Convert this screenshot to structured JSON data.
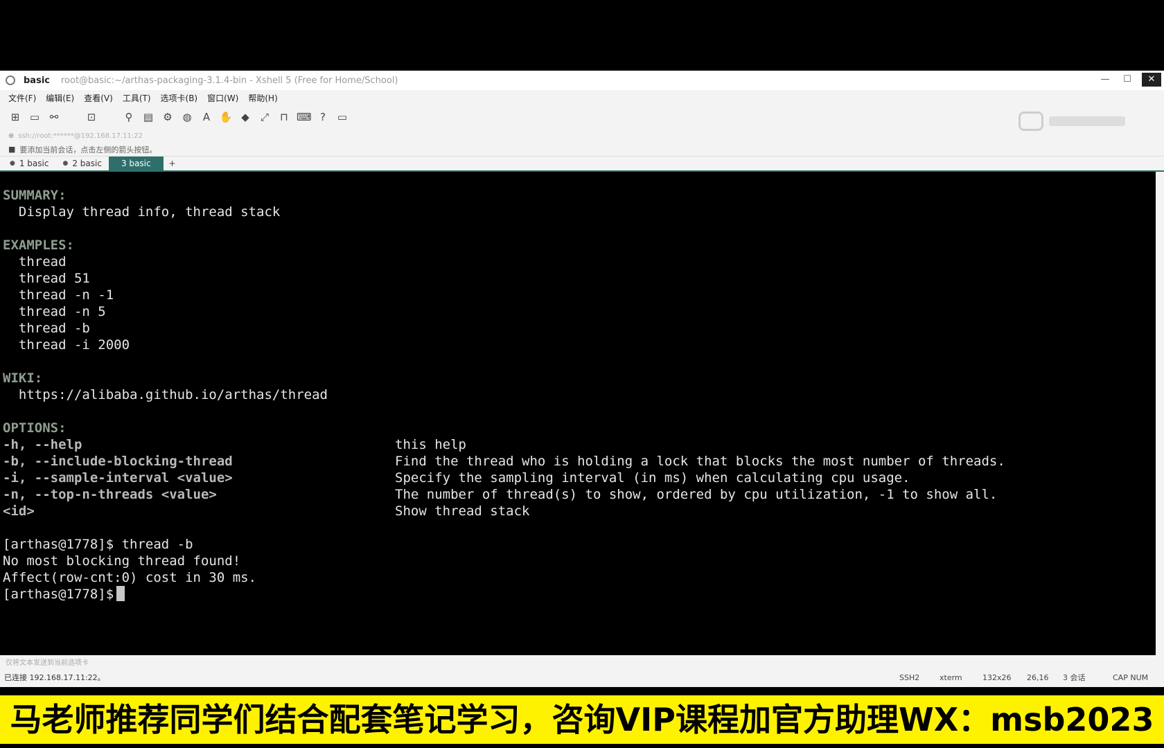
{
  "titlebar": {
    "session_name": "basic",
    "title": "root@basic:~/arthas-packaging-3.1.4-bin - Xshell 5 (Free for Home/School)",
    "min_glyph": "—",
    "max_glyph": "☐",
    "close_glyph": "✕"
  },
  "menu": [
    "文件(F)",
    "编辑(E)",
    "查看(V)",
    "工具(T)",
    "选项卡(B)",
    "窗口(W)",
    "帮助(H)"
  ],
  "addressbar": {
    "icon": "⊕",
    "text": "ssh://root:******@192.168.17.11:22"
  },
  "hintbar": {
    "icon": "■",
    "text": "要添加当前会话，点击左侧的箭头按钮。"
  },
  "tabs": [
    {
      "label": "1 basic",
      "dot": "●"
    },
    {
      "label": "2 basic",
      "dot": "●"
    },
    {
      "label": "3 basic",
      "active": true
    }
  ],
  "tab_add": "+",
  "terminal": {
    "summary_header": "SUMMARY:",
    "summary_text": "  Display thread info, thread stack",
    "examples_header": "EXAMPLES:",
    "examples": [
      "  thread",
      "  thread 51",
      "  thread -n -1",
      "  thread -n 5",
      "  thread -b",
      "  thread -i 2000"
    ],
    "wiki_header": "WIKI:",
    "wiki_url": "  https://alibaba.github.io/arthas/thread",
    "options_header": "OPTIONS:",
    "options": [
      {
        "flag": "-h, --help",
        "desc": "this help"
      },
      {
        "flag": "-b, --include-blocking-thread",
        "desc": "Find the thread who is holding a lock that blocks the most number of threads."
      },
      {
        "flag": "-i, --sample-interval <value>",
        "desc": "Specify the sampling interval (in ms) when calculating cpu usage."
      },
      {
        "flag": "-n, --top-n-threads <value>",
        "desc": "The number of thread(s) to show, ordered by cpu utilization, -1 to show all."
      },
      {
        "flag": "<id>",
        "desc": "Show thread stack"
      }
    ],
    "cmd_line": "[arthas@1778]$ thread -b",
    "result_line": "No most blocking thread found!",
    "affect_line": "Affect(row-cnt:0) cost in 30 ms.",
    "prompt": "[arthas@1778]$"
  },
  "statusbar1": {
    "text": "仅将文本发送到当前选项卡"
  },
  "statusbar2": {
    "connection": "已连接 192.168.17.11:22。",
    "protocol": "SSH2",
    "term_type": "xterm",
    "size": "132x26",
    "cursor_pos": "26,16",
    "sessions": "3 会话",
    "caps": "CAP NUM"
  },
  "banner": {
    "text": "马老师推荐同学们结合配套笔记学习，咨询VIP课程加官方助理WX：msb2023"
  }
}
